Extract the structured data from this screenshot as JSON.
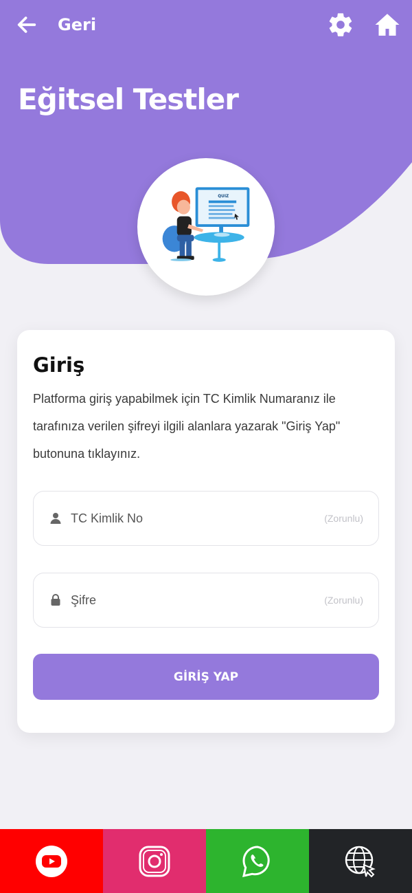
{
  "colors": {
    "primary": "#9479dc",
    "background": "#f1f0f5",
    "youtube": "#ff0000",
    "instagram": "#e12d6e",
    "whatsapp": "#2db42e",
    "web": "#222427"
  },
  "header": {
    "back_label": "Geri",
    "title": "Eğitsel Testler",
    "settings_icon": "gear-icon",
    "home_icon": "home-icon",
    "illustration_label": "QUIZ"
  },
  "login": {
    "title": "Giriş",
    "description": "Platforma giriş yapabilmek için TC Kimlik Numaranız ile tarafınıza verilen şifreyi ilgili alanlara yazarak \"Giriş Yap\" butonuna tıklayınız.",
    "tc_field": {
      "placeholder": "TC Kimlik No",
      "required_label": "(Zorunlu)",
      "value": ""
    },
    "password_field": {
      "placeholder": "Şifre",
      "required_label": "(Zorunlu)",
      "value": ""
    },
    "submit_label": "GİRİŞ YAP"
  },
  "social": [
    {
      "name": "youtube",
      "icon": "youtube-icon"
    },
    {
      "name": "instagram",
      "icon": "instagram-icon"
    },
    {
      "name": "whatsapp",
      "icon": "whatsapp-icon"
    },
    {
      "name": "web",
      "icon": "globe-icon"
    }
  ]
}
